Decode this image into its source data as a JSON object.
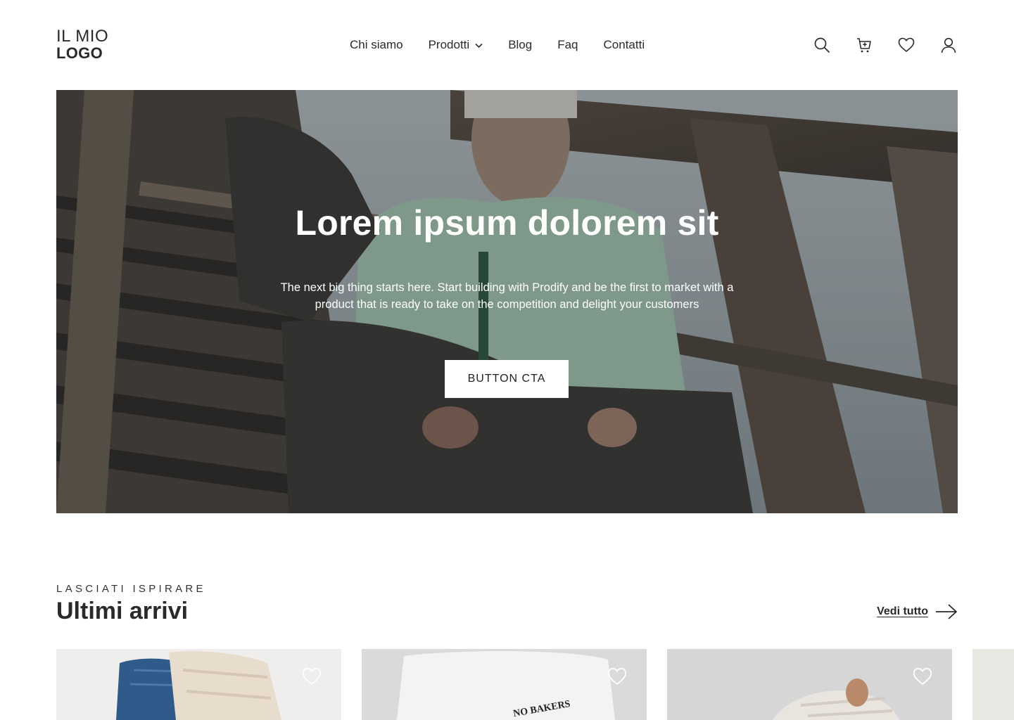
{
  "header": {
    "logo_line1": "IL MIO",
    "logo_line2": "LOGO",
    "nav": [
      {
        "label": "Chi siamo"
      },
      {
        "label": "Prodotti",
        "has_dropdown": true
      },
      {
        "label": "Blog"
      },
      {
        "label": "Faq"
      },
      {
        "label": "Contatti"
      }
    ],
    "icons": [
      "search-icon",
      "cart-icon",
      "heart-icon",
      "user-icon"
    ]
  },
  "hero": {
    "title": "Lorem ipsum dolorem sit",
    "subtitle": "The next big thing starts here. Start building with Prodify and be the first to market with a product that is ready to take on the competition and delight your customers",
    "cta_label": "BUTTON CTA"
  },
  "section": {
    "eyebrow": "LASCIATI ISPIRARE",
    "title": "Ultimi arrivi",
    "see_all_label": "Vedi tutto"
  },
  "products": [
    {
      "icon": "heart-icon"
    },
    {
      "icon": "heart-icon",
      "print_text": "NO BAKERS"
    },
    {
      "icon": "heart-icon"
    },
    {}
  ],
  "colors": {
    "text": "#2a2a2a",
    "background": "#ffffff",
    "cta_background": "#ffffff",
    "hero_text": "#ffffff"
  }
}
